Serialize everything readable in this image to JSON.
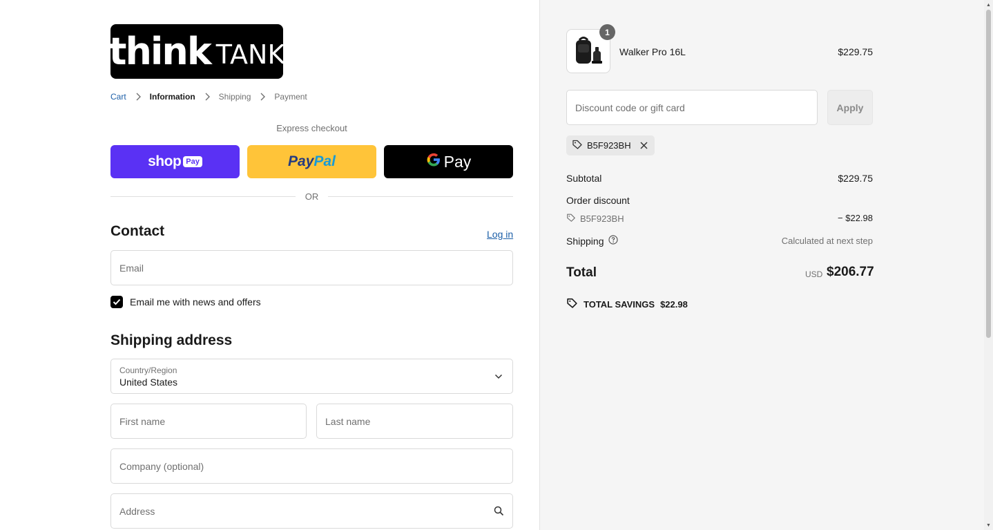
{
  "brand": {
    "logo_bold": "think",
    "logo_light": "TANK"
  },
  "breadcrumb": [
    {
      "label": "Cart"
    },
    {
      "label": "Information"
    },
    {
      "label": "Shipping"
    },
    {
      "label": "Payment"
    }
  ],
  "express": {
    "label": "Express checkout",
    "shop_pay": {
      "text": "shop",
      "badge": "Pay"
    },
    "paypal": {
      "part1": "Pay",
      "part2": "Pal"
    },
    "gpay": {
      "g": "G",
      "text": "Pay"
    },
    "or_label": "OR"
  },
  "contact": {
    "heading": "Contact",
    "login_label": "Log in",
    "email_placeholder": "Email",
    "newsletter_label": "Email me with news and offers",
    "newsletter_checked": true
  },
  "shipping": {
    "heading": "Shipping address",
    "country_label": "Country/Region",
    "country_value": "United States",
    "first_name_placeholder": "First name",
    "last_name_placeholder": "Last name",
    "company_placeholder": "Company (optional)",
    "address_placeholder": "Address"
  },
  "summary": {
    "item": {
      "name": "Walker Pro 16L",
      "price": "$229.75",
      "quantity": "1"
    },
    "discount_placeholder": "Discount code or gift card",
    "apply_label": "Apply",
    "applied_code": "B5F923BH",
    "subtotal_label": "Subtotal",
    "subtotal_value": "$229.75",
    "order_discount_label": "Order discount",
    "order_discount_code": "B5F923BH",
    "order_discount_value": "− $22.98",
    "shipping_label": "Shipping",
    "shipping_value": "Calculated at next step",
    "total_label": "Total",
    "total_currency": "USD",
    "total_value": "$206.77",
    "savings_label": "TOTAL SAVINGS",
    "savings_value": "$22.98"
  },
  "colors": {
    "link": "#1c5fa8",
    "shop_pay": "#5a31f4",
    "paypal": "#ffc439",
    "gpay": "#000000",
    "summary_bg": "#f5f5f5"
  }
}
